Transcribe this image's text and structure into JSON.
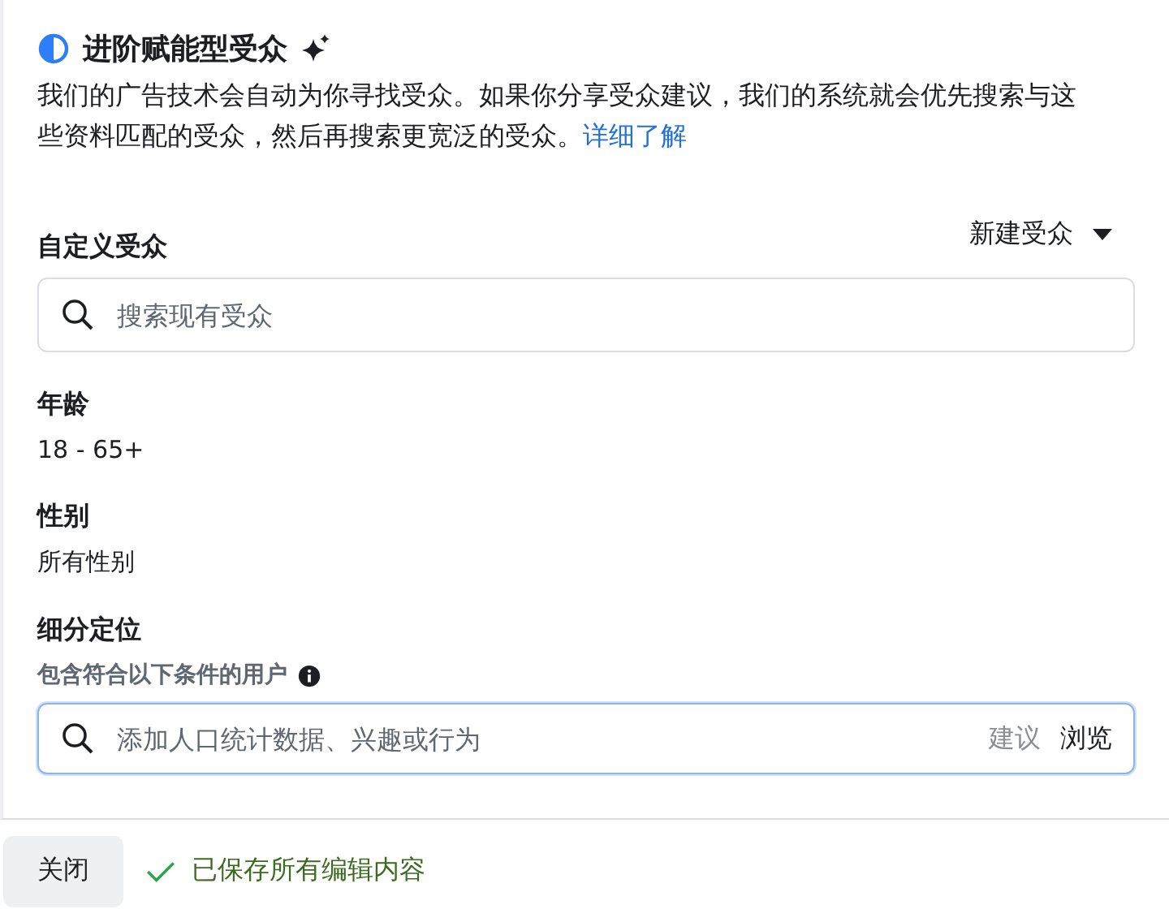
{
  "section": {
    "title": "进阶赋能型受众",
    "description": "我们的广告技术会自动为你寻找受众。如果你分享受众建议，我们的系统就会优先搜索与这些资料匹配的受众，然后再搜索更宽泛的受众。",
    "learn_more": "详细了解"
  },
  "custom_audience": {
    "label": "自定义受众",
    "new_button": "新建受众",
    "search": {
      "placeholder": "搜索现有受众"
    }
  },
  "fields": [
    {
      "label": "年龄",
      "value": "18 - 65+"
    },
    {
      "label": "性别",
      "value": "所有性别"
    }
  ],
  "targeting": {
    "label": "细分定位",
    "hint": "包含符合以下条件的用户",
    "search": {
      "placeholder": "添加人口统计数据、兴趣或行为",
      "focused": true
    },
    "actions": [
      "建议",
      "浏览"
    ]
  },
  "footer": {
    "close_button": "关闭",
    "status": "已保存所有编辑内容"
  }
}
